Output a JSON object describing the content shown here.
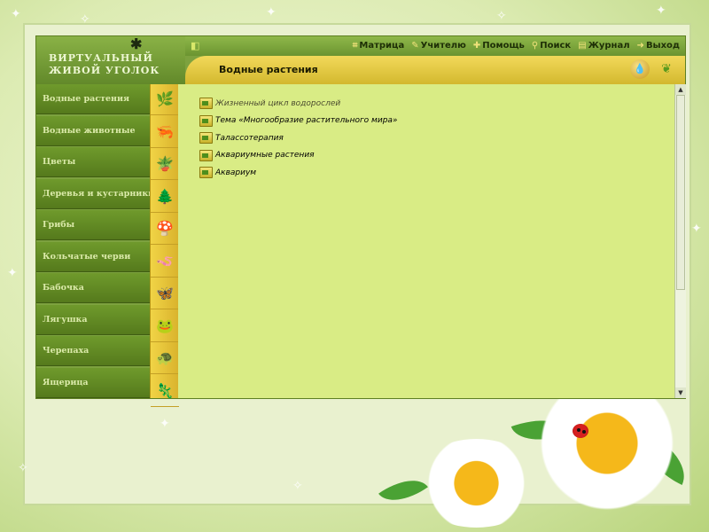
{
  "logo": {
    "line1": "ВИРТУАЛЬНЫЙ",
    "line2": "ЖИВОЙ УГОЛОК"
  },
  "topnav": {
    "collapse_icon": "collapse-left-icon",
    "items": [
      {
        "label": "Матрица",
        "icon": "matrix-icon"
      },
      {
        "label": "Учителю",
        "icon": "teacher-icon"
      },
      {
        "label": "Помощь",
        "icon": "help-icon"
      },
      {
        "label": "Поиск",
        "icon": "search-icon"
      },
      {
        "label": "Журнал",
        "icon": "journal-icon"
      },
      {
        "label": "Выход",
        "icon": "exit-icon"
      }
    ]
  },
  "titlebar": {
    "title": "Водные растения",
    "drop_icon": "water-drop-icon",
    "help_icon": "leaf-help-icon"
  },
  "sidebar": {
    "items": [
      {
        "label": "Водные растения",
        "icon": "water-plant-icon",
        "glyph": "🌿"
      },
      {
        "label": "Водные животные",
        "icon": "shrimp-icon",
        "glyph": "🦐"
      },
      {
        "label": "Цветы",
        "icon": "potted-flower-icon",
        "glyph": "🪴"
      },
      {
        "label": "Деревья и кустарники",
        "icon": "tree-branch-icon",
        "glyph": "🌲"
      },
      {
        "label": "Грибы",
        "icon": "mushroom-icon",
        "glyph": "🍄"
      },
      {
        "label": "Кольчатые черви",
        "icon": "worm-icon",
        "glyph": "🪱"
      },
      {
        "label": "Бабочка",
        "icon": "butterfly-icon",
        "glyph": "🦋"
      },
      {
        "label": "Лягушка",
        "icon": "frog-icon",
        "glyph": "🐸"
      },
      {
        "label": "Черепаха",
        "icon": "turtle-icon",
        "glyph": "🐢"
      },
      {
        "label": "Ящерица",
        "icon": "lizard-icon",
        "glyph": "🦎"
      }
    ]
  },
  "content": {
    "items": [
      {
        "label": "Жизненный цикл водорослей",
        "icon": "folder-icon"
      },
      {
        "label": "Тема «Многообразие растительного мира»",
        "icon": "folder-icon"
      },
      {
        "label": "Талассотерапия",
        "icon": "folder-icon"
      },
      {
        "label": "Аквариумные растения",
        "icon": "folder-icon"
      },
      {
        "label": "Аквариум",
        "icon": "folder-icon"
      }
    ]
  },
  "colors": {
    "sidebar": "#6f9a2c",
    "titlebar": "#e8cc45",
    "content": "#d9ec85",
    "icon_column": "#f1d446"
  }
}
